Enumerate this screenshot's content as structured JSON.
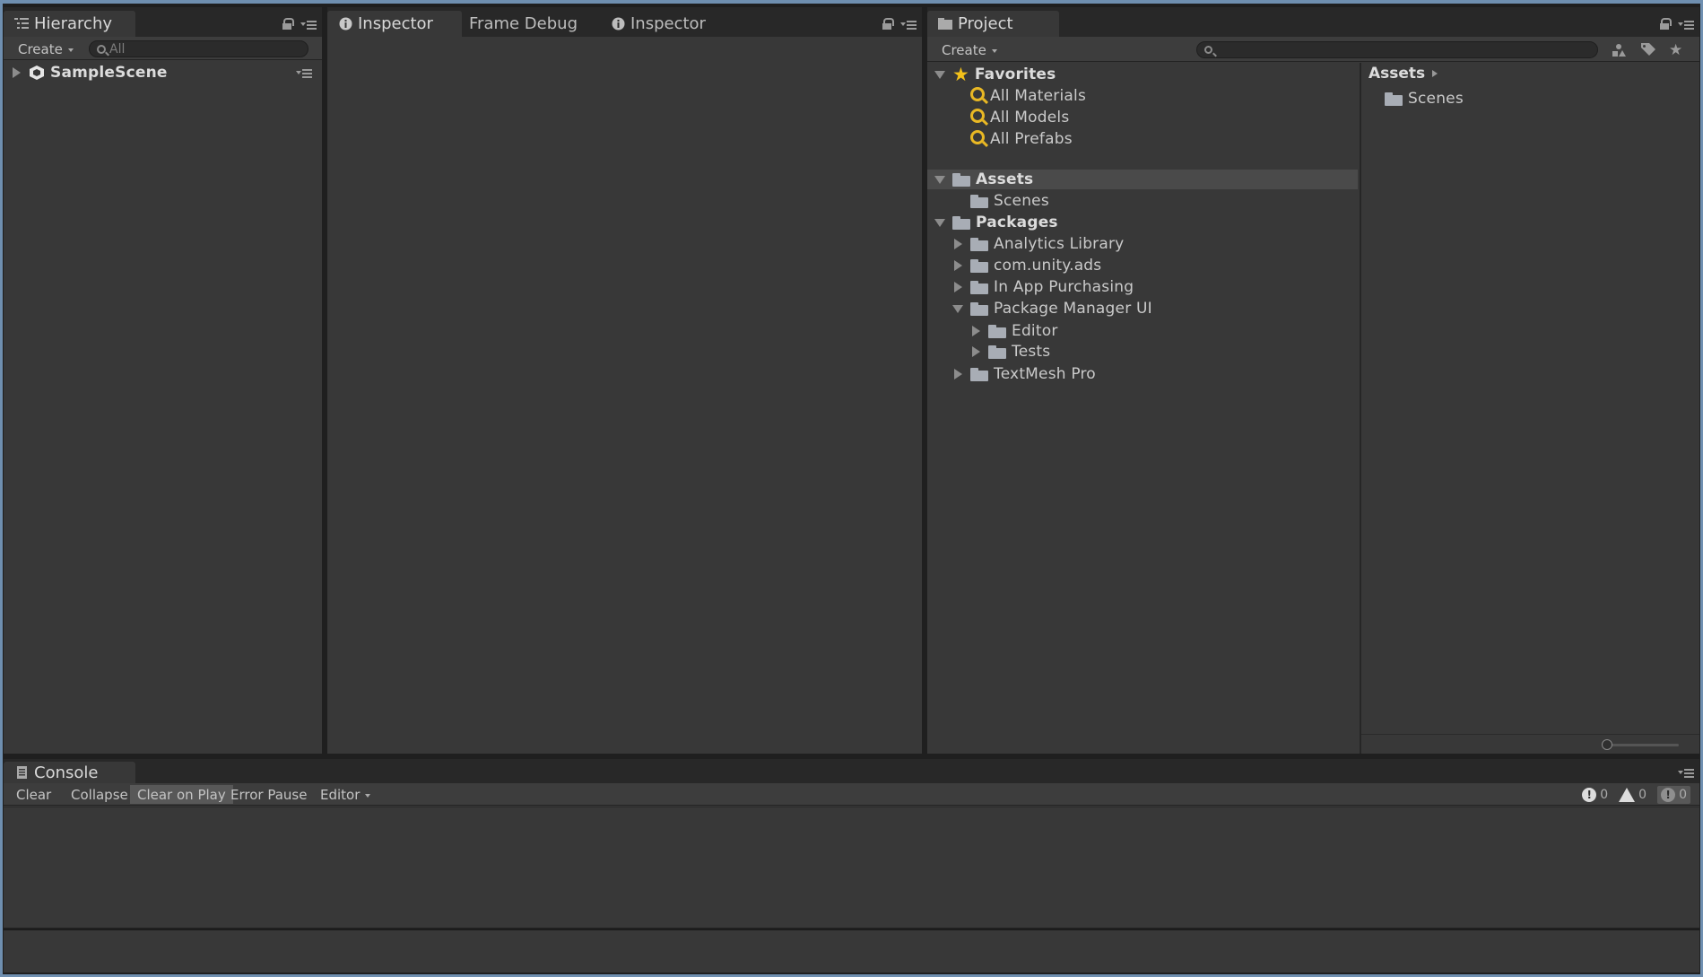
{
  "hierarchy": {
    "tab_label": "Hierarchy",
    "create_label": "Create",
    "search_placeholder": "All",
    "scene_name": "SampleScene"
  },
  "inspector_group": {
    "tabs": [
      {
        "label": "Inspector",
        "icon": "info-icon"
      },
      {
        "label": "Frame Debug",
        "icon": ""
      },
      {
        "label": "Inspector",
        "icon": "info-icon"
      }
    ]
  },
  "project": {
    "tab_label": "Project",
    "create_label": "Create",
    "search_placeholder": "",
    "favorites": {
      "label": "Favorites",
      "items": [
        "All Materials",
        "All Models",
        "All Prefabs"
      ]
    },
    "assets": {
      "label": "Assets",
      "children": [
        "Scenes"
      ]
    },
    "packages": {
      "label": "Packages",
      "children": [
        {
          "label": "Analytics Library",
          "expanded": false
        },
        {
          "label": "com.unity.ads",
          "expanded": false
        },
        {
          "label": "In App Purchasing",
          "expanded": false
        },
        {
          "label": "Package Manager UI",
          "expanded": true,
          "children": [
            "Editor",
            "Tests"
          ]
        },
        {
          "label": "TextMesh Pro",
          "expanded": false
        }
      ]
    },
    "right_pane": {
      "breadcrumb": "Assets",
      "items": [
        "Scenes"
      ]
    }
  },
  "console": {
    "tab_label": "Console",
    "buttons": {
      "clear": "Clear",
      "collapse": "Collapse",
      "clear_on_play": "Clear on Play",
      "error_pause": "Error Pause",
      "editor": "Editor"
    },
    "counts": {
      "info": "0",
      "warning": "0",
      "error": "0"
    }
  }
}
